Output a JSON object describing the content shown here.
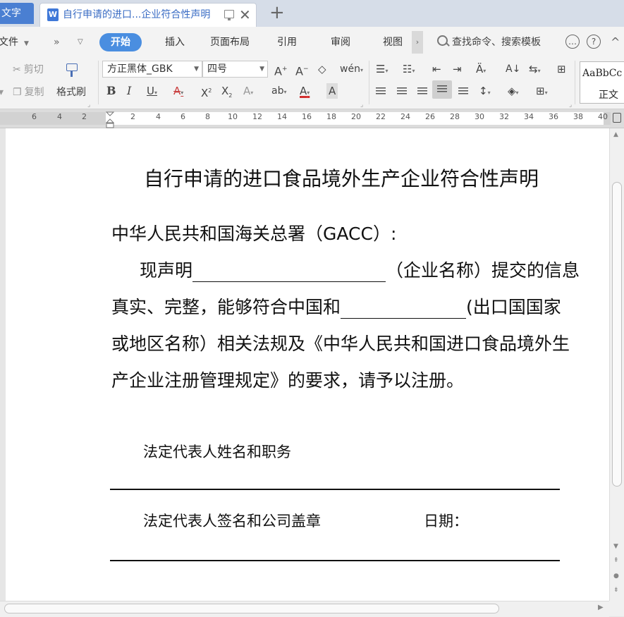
{
  "app_tab": {
    "label": "文字"
  },
  "document_tab": {
    "icon_letter": "W",
    "title": "自行申请的进口...企业符合性声明"
  },
  "menu": {
    "file": "文件",
    "tabs": [
      "开始",
      "插入",
      "页面布局",
      "引用",
      "审阅",
      "视图"
    ],
    "active_tab": "开始",
    "search_placeholder": "查找命令、搜索模板"
  },
  "toolbar": {
    "cut": "剪切",
    "copy": "复制",
    "format_painter": "格式刷",
    "font_name": "方正黑体_GBK",
    "font_size": "四号",
    "style_sample": "AaBbCc",
    "style_name": "正文"
  },
  "ruler": {
    "labels": [
      "6",
      "4",
      "2",
      "2",
      "4",
      "6",
      "8",
      "10",
      "12",
      "14",
      "16",
      "18",
      "20",
      "22",
      "24",
      "26",
      "28",
      "30",
      "32",
      "34",
      "36",
      "38",
      "40"
    ]
  },
  "document": {
    "heading": "自行申请的进口食品境外生产企业符合性声明",
    "salutation": "中华人民共和国海关总署（GACC）:",
    "p1_start": "现声明",
    "p1_end": "（企业名称）提交的信息",
    "p2_start": "真实、完整，能够符合中国和",
    "p2_end": "(出口国国家",
    "p3": "或地区名称）相关法规及《中华人民共和国进口食品境外生",
    "p4": "产企业注册管理规定》的要求，请予以注册。",
    "rep_name_label": "法定代表人姓名和职务",
    "rep_sign_label": "法定代表人签名和公司盖章",
    "date_label": "日期："
  },
  "colors": {
    "accent": "#4a8ee0",
    "tab_bar": "#d6dde8",
    "doc_tab_text": "#3a6cc4"
  }
}
